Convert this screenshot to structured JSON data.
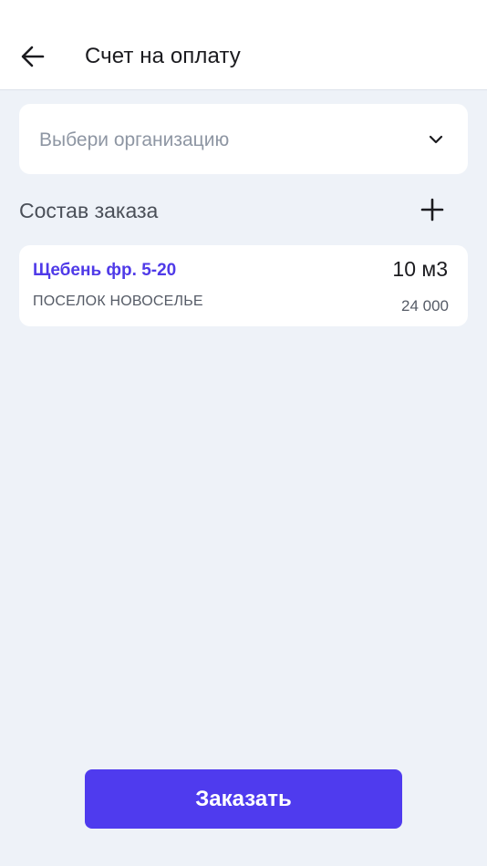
{
  "header": {
    "title": "Счет на оплату",
    "back_icon": "arrow-left-icon"
  },
  "organization_select": {
    "placeholder": "Выбери организацию",
    "icon": "chevron-down-icon"
  },
  "order_section": {
    "title": "Состав заказа",
    "add_icon": "plus-icon"
  },
  "order_items": [
    {
      "name": "Щебень фр. 5-20",
      "quantity": "10 м3",
      "location": "ПОСЕЛОК НОВОСЕЛЬЕ",
      "price": "24 000"
    }
  ],
  "footer": {
    "order_button_label": "Заказать"
  },
  "colors": {
    "accent": "#4f3bee",
    "background": "#eef2f8",
    "card": "#ffffff"
  }
}
